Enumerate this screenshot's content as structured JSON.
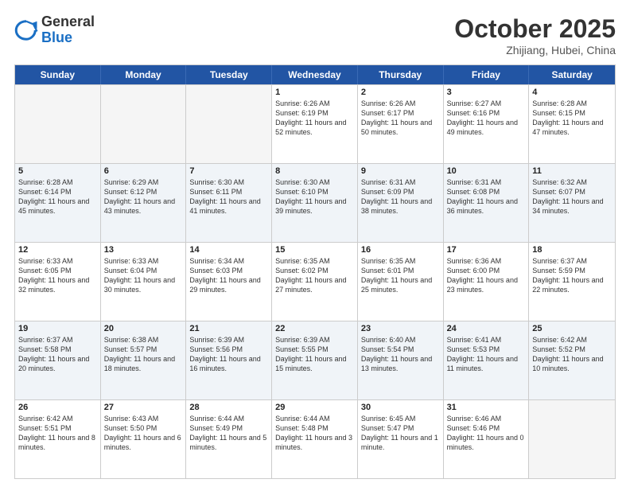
{
  "header": {
    "logo": {
      "line1": "General",
      "line2": "Blue"
    },
    "title": "October 2025",
    "location": "Zhijiang, Hubei, China"
  },
  "weekdays": [
    "Sunday",
    "Monday",
    "Tuesday",
    "Wednesday",
    "Thursday",
    "Friday",
    "Saturday"
  ],
  "rows": [
    {
      "alt": false,
      "cells": [
        {
          "day": "",
          "sunrise": "",
          "sunset": "",
          "daylight": "",
          "empty": true
        },
        {
          "day": "",
          "sunrise": "",
          "sunset": "",
          "daylight": "",
          "empty": true
        },
        {
          "day": "",
          "sunrise": "",
          "sunset": "",
          "daylight": "",
          "empty": true
        },
        {
          "day": "1",
          "sunrise": "Sunrise: 6:26 AM",
          "sunset": "Sunset: 6:19 PM",
          "daylight": "Daylight: 11 hours and 52 minutes.",
          "empty": false
        },
        {
          "day": "2",
          "sunrise": "Sunrise: 6:26 AM",
          "sunset": "Sunset: 6:17 PM",
          "daylight": "Daylight: 11 hours and 50 minutes.",
          "empty": false
        },
        {
          "day": "3",
          "sunrise": "Sunrise: 6:27 AM",
          "sunset": "Sunset: 6:16 PM",
          "daylight": "Daylight: 11 hours and 49 minutes.",
          "empty": false
        },
        {
          "day": "4",
          "sunrise": "Sunrise: 6:28 AM",
          "sunset": "Sunset: 6:15 PM",
          "daylight": "Daylight: 11 hours and 47 minutes.",
          "empty": false
        }
      ]
    },
    {
      "alt": true,
      "cells": [
        {
          "day": "5",
          "sunrise": "Sunrise: 6:28 AM",
          "sunset": "Sunset: 6:14 PM",
          "daylight": "Daylight: 11 hours and 45 minutes.",
          "empty": false
        },
        {
          "day": "6",
          "sunrise": "Sunrise: 6:29 AM",
          "sunset": "Sunset: 6:12 PM",
          "daylight": "Daylight: 11 hours and 43 minutes.",
          "empty": false
        },
        {
          "day": "7",
          "sunrise": "Sunrise: 6:30 AM",
          "sunset": "Sunset: 6:11 PM",
          "daylight": "Daylight: 11 hours and 41 minutes.",
          "empty": false
        },
        {
          "day": "8",
          "sunrise": "Sunrise: 6:30 AM",
          "sunset": "Sunset: 6:10 PM",
          "daylight": "Daylight: 11 hours and 39 minutes.",
          "empty": false
        },
        {
          "day": "9",
          "sunrise": "Sunrise: 6:31 AM",
          "sunset": "Sunset: 6:09 PM",
          "daylight": "Daylight: 11 hours and 38 minutes.",
          "empty": false
        },
        {
          "day": "10",
          "sunrise": "Sunrise: 6:31 AM",
          "sunset": "Sunset: 6:08 PM",
          "daylight": "Daylight: 11 hours and 36 minutes.",
          "empty": false
        },
        {
          "day": "11",
          "sunrise": "Sunrise: 6:32 AM",
          "sunset": "Sunset: 6:07 PM",
          "daylight": "Daylight: 11 hours and 34 minutes.",
          "empty": false
        }
      ]
    },
    {
      "alt": false,
      "cells": [
        {
          "day": "12",
          "sunrise": "Sunrise: 6:33 AM",
          "sunset": "Sunset: 6:05 PM",
          "daylight": "Daylight: 11 hours and 32 minutes.",
          "empty": false
        },
        {
          "day": "13",
          "sunrise": "Sunrise: 6:33 AM",
          "sunset": "Sunset: 6:04 PM",
          "daylight": "Daylight: 11 hours and 30 minutes.",
          "empty": false
        },
        {
          "day": "14",
          "sunrise": "Sunrise: 6:34 AM",
          "sunset": "Sunset: 6:03 PM",
          "daylight": "Daylight: 11 hours and 29 minutes.",
          "empty": false
        },
        {
          "day": "15",
          "sunrise": "Sunrise: 6:35 AM",
          "sunset": "Sunset: 6:02 PM",
          "daylight": "Daylight: 11 hours and 27 minutes.",
          "empty": false
        },
        {
          "day": "16",
          "sunrise": "Sunrise: 6:35 AM",
          "sunset": "Sunset: 6:01 PM",
          "daylight": "Daylight: 11 hours and 25 minutes.",
          "empty": false
        },
        {
          "day": "17",
          "sunrise": "Sunrise: 6:36 AM",
          "sunset": "Sunset: 6:00 PM",
          "daylight": "Daylight: 11 hours and 23 minutes.",
          "empty": false
        },
        {
          "day": "18",
          "sunrise": "Sunrise: 6:37 AM",
          "sunset": "Sunset: 5:59 PM",
          "daylight": "Daylight: 11 hours and 22 minutes.",
          "empty": false
        }
      ]
    },
    {
      "alt": true,
      "cells": [
        {
          "day": "19",
          "sunrise": "Sunrise: 6:37 AM",
          "sunset": "Sunset: 5:58 PM",
          "daylight": "Daylight: 11 hours and 20 minutes.",
          "empty": false
        },
        {
          "day": "20",
          "sunrise": "Sunrise: 6:38 AM",
          "sunset": "Sunset: 5:57 PM",
          "daylight": "Daylight: 11 hours and 18 minutes.",
          "empty": false
        },
        {
          "day": "21",
          "sunrise": "Sunrise: 6:39 AM",
          "sunset": "Sunset: 5:56 PM",
          "daylight": "Daylight: 11 hours and 16 minutes.",
          "empty": false
        },
        {
          "day": "22",
          "sunrise": "Sunrise: 6:39 AM",
          "sunset": "Sunset: 5:55 PM",
          "daylight": "Daylight: 11 hours and 15 minutes.",
          "empty": false
        },
        {
          "day": "23",
          "sunrise": "Sunrise: 6:40 AM",
          "sunset": "Sunset: 5:54 PM",
          "daylight": "Daylight: 11 hours and 13 minutes.",
          "empty": false
        },
        {
          "day": "24",
          "sunrise": "Sunrise: 6:41 AM",
          "sunset": "Sunset: 5:53 PM",
          "daylight": "Daylight: 11 hours and 11 minutes.",
          "empty": false
        },
        {
          "day": "25",
          "sunrise": "Sunrise: 6:42 AM",
          "sunset": "Sunset: 5:52 PM",
          "daylight": "Daylight: 11 hours and 10 minutes.",
          "empty": false
        }
      ]
    },
    {
      "alt": false,
      "cells": [
        {
          "day": "26",
          "sunrise": "Sunrise: 6:42 AM",
          "sunset": "Sunset: 5:51 PM",
          "daylight": "Daylight: 11 hours and 8 minutes.",
          "empty": false
        },
        {
          "day": "27",
          "sunrise": "Sunrise: 6:43 AM",
          "sunset": "Sunset: 5:50 PM",
          "daylight": "Daylight: 11 hours and 6 minutes.",
          "empty": false
        },
        {
          "day": "28",
          "sunrise": "Sunrise: 6:44 AM",
          "sunset": "Sunset: 5:49 PM",
          "daylight": "Daylight: 11 hours and 5 minutes.",
          "empty": false
        },
        {
          "day": "29",
          "sunrise": "Sunrise: 6:44 AM",
          "sunset": "Sunset: 5:48 PM",
          "daylight": "Daylight: 11 hours and 3 minutes.",
          "empty": false
        },
        {
          "day": "30",
          "sunrise": "Sunrise: 6:45 AM",
          "sunset": "Sunset: 5:47 PM",
          "daylight": "Daylight: 11 hours and 1 minute.",
          "empty": false
        },
        {
          "day": "31",
          "sunrise": "Sunrise: 6:46 AM",
          "sunset": "Sunset: 5:46 PM",
          "daylight": "Daylight: 11 hours and 0 minutes.",
          "empty": false
        },
        {
          "day": "",
          "sunrise": "",
          "sunset": "",
          "daylight": "",
          "empty": true
        }
      ]
    }
  ]
}
